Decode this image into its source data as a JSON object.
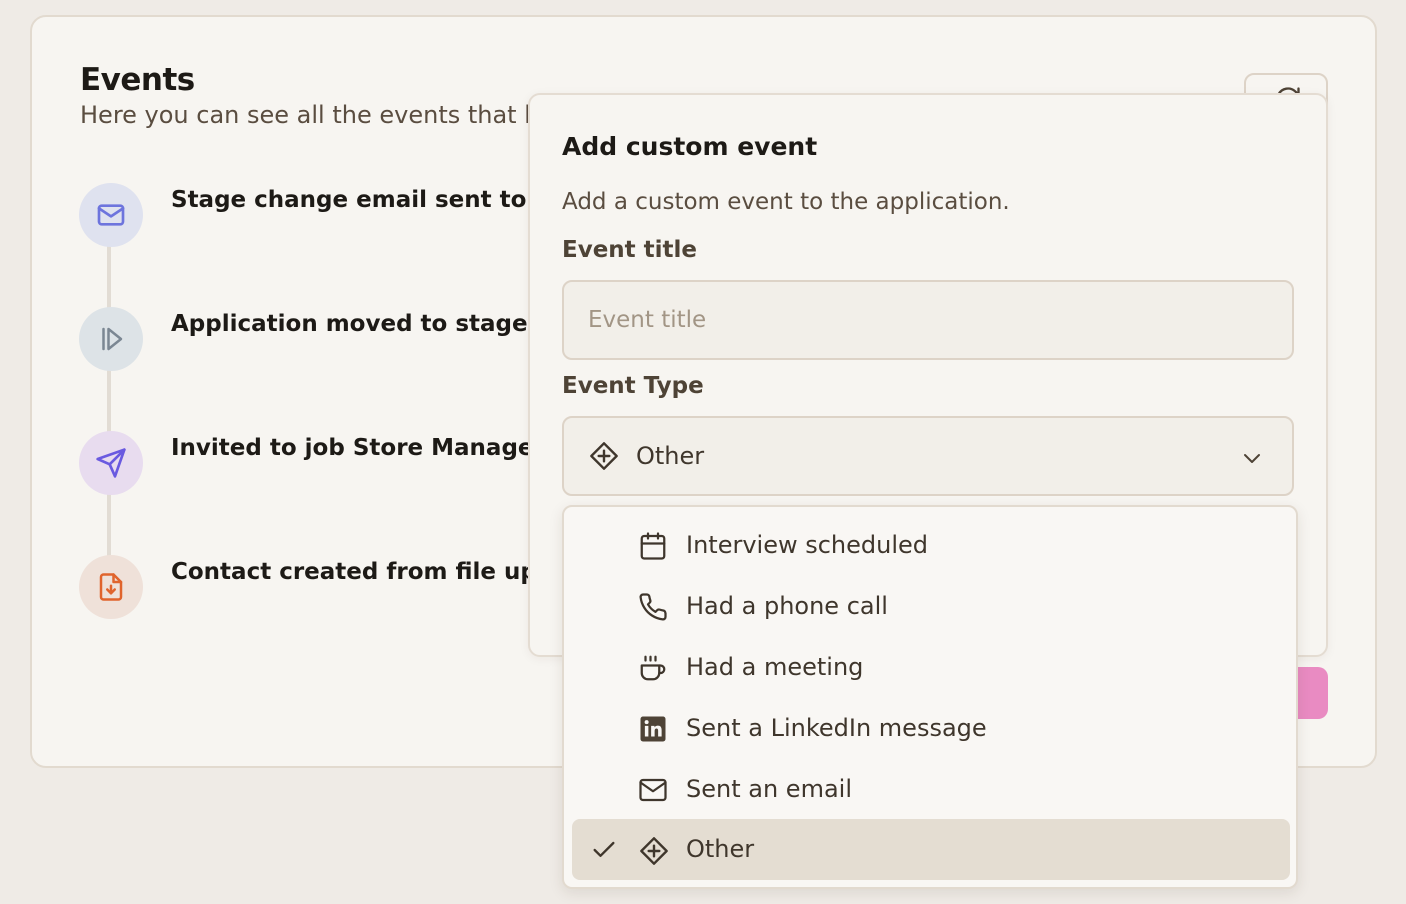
{
  "events_card": {
    "title": "Events",
    "subtitle": "Here you can see all the events that h",
    "items": [
      {
        "label": "Stage change email sent to b",
        "icon": "mail-icon",
        "color": "#6d74dd",
        "bg": "#dfe2ef"
      },
      {
        "label": "Application moved to stage C",
        "icon": "skip-forward-icon",
        "color": "#7b8793",
        "bg": "#dde3e7"
      },
      {
        "label": "Invited to job Store Manager",
        "icon": "send-icon",
        "color": "#8a4fe3",
        "bg": "#e8dcef"
      },
      {
        "label": "Contact created from file upl",
        "icon": "file-download-icon",
        "color": "#e0642d",
        "bg": "#efe1d9"
      }
    ]
  },
  "modal": {
    "title": "Add custom event",
    "description": "Add a custom event to the application.",
    "event_title_label": "Event title",
    "event_title_placeholder": "Event title",
    "event_title_value": "",
    "event_type_label": "Event Type",
    "event_type_selected": "Other"
  },
  "dropdown": {
    "options": [
      {
        "label": "Interview scheduled",
        "icon": "calendar-icon",
        "selected": false
      },
      {
        "label": "Had a phone call",
        "icon": "phone-icon",
        "selected": false
      },
      {
        "label": "Had a meeting",
        "icon": "coffee-icon",
        "selected": false
      },
      {
        "label": "Sent a LinkedIn message",
        "icon": "linkedin-icon",
        "selected": false
      },
      {
        "label": "Sent an email",
        "icon": "mail-icon",
        "selected": false
      },
      {
        "label": "Other",
        "icon": "diamond-plus-icon",
        "selected": true
      }
    ]
  },
  "colors": {
    "accent_pink": "#e98bc2",
    "selected_bg": "#e4ddd2",
    "background": "#efebe6"
  }
}
